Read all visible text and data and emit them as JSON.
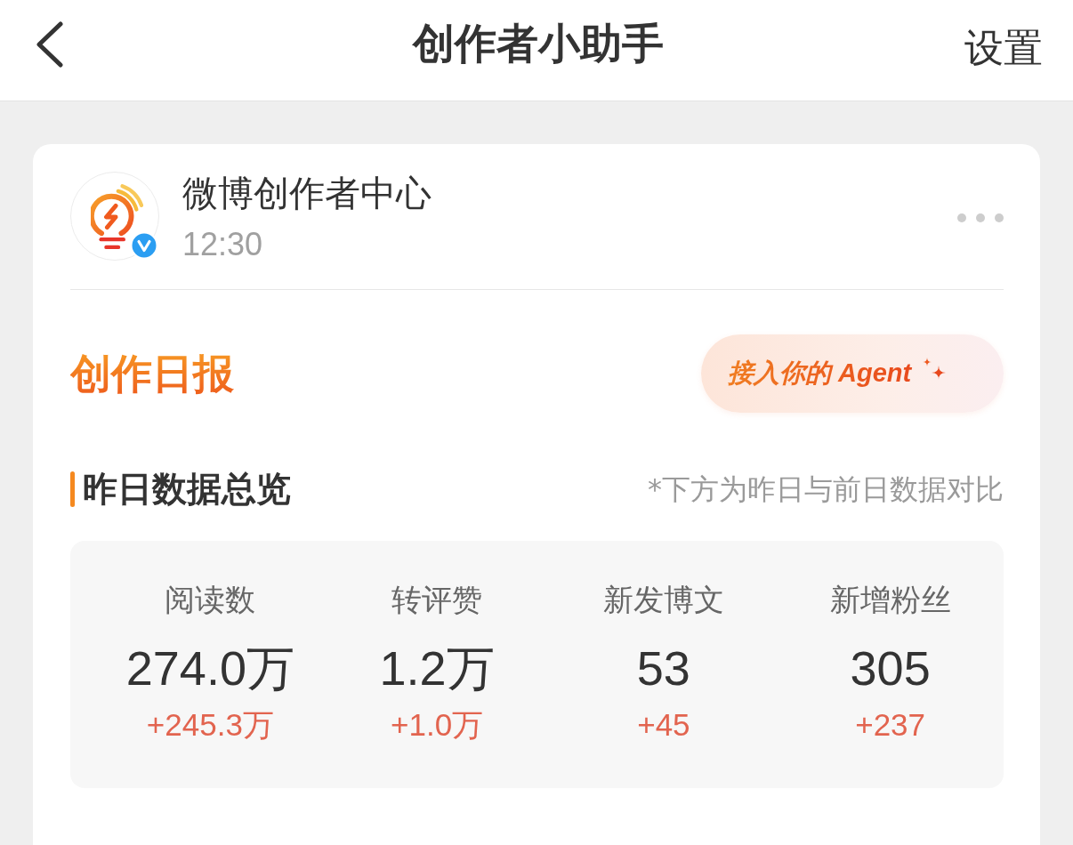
{
  "header": {
    "title": "创作者小助手",
    "action": "设置"
  },
  "post": {
    "author": "微博创作者中心",
    "time": "12:30",
    "verified": true
  },
  "report": {
    "title": "创作日报",
    "agent_button": "接入你的 Agent"
  },
  "overview": {
    "title": "昨日数据总览",
    "note": "*下方为昨日与前日数据对比",
    "stats": [
      {
        "label": "阅读数",
        "value": "274.0万",
        "change": "+245.3万"
      },
      {
        "label": "转评赞",
        "value": "1.2万",
        "change": "+1.0万"
      },
      {
        "label": "新发博文",
        "value": "53",
        "change": "+45"
      },
      {
        "label": "新增粉丝",
        "value": "305",
        "change": "+237"
      }
    ]
  }
}
